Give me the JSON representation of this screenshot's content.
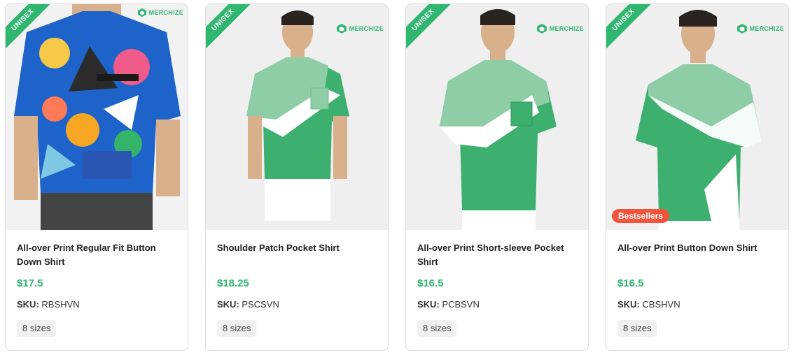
{
  "colors": {
    "accent": "#2fb66f",
    "bestseller": "#f4533c",
    "shirt_green": "#3daf6f",
    "shirt_light": "#8fcda6"
  },
  "products": [
    {
      "badge": "UNISEX",
      "brand": "MERCHIZE",
      "title": "All-over Print Regular Fit Button Down Shirt",
      "price": "$17.5",
      "sku_label": "SKU:",
      "sku": "RBSHVN",
      "sizes": "8 sizes",
      "tag": ""
    },
    {
      "badge": "UNISEX",
      "brand": "MERCHIZE",
      "title": "Shoulder Patch Pocket Shirt",
      "price": "$18.25",
      "sku_label": "SKU:",
      "sku": "PSCSVN",
      "sizes": "8 sizes",
      "tag": ""
    },
    {
      "badge": "UNISEX",
      "brand": "MERCHIZE",
      "title": "All-over Print Short-sleeve Pocket Shirt",
      "price": "$16.5",
      "sku_label": "SKU:",
      "sku": "PCBSVN",
      "sizes": "8 sizes",
      "tag": ""
    },
    {
      "badge": "UNISEX",
      "brand": "MERCHIZE",
      "title": "All-over Print Button Down Shirt",
      "price": "$16.5",
      "sku_label": "SKU:",
      "sku": "CBSHVN",
      "sizes": "8 sizes",
      "tag": "Bestsellers"
    }
  ]
}
